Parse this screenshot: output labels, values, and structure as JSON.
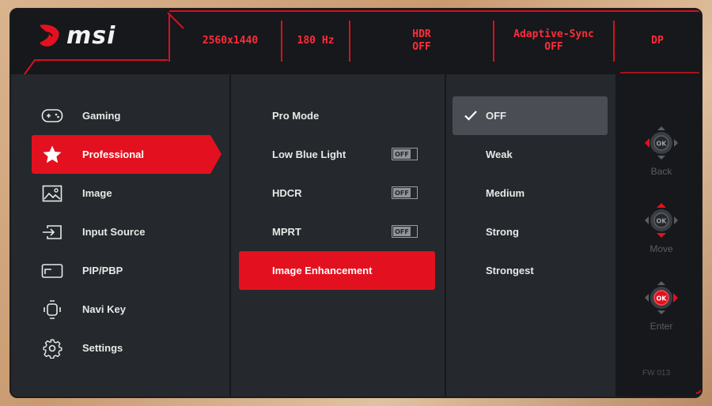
{
  "brand": {
    "name": "msi"
  },
  "status": [
    {
      "lines": [
        "2560x1440"
      ]
    },
    {
      "lines": [
        "180 Hz"
      ]
    },
    {
      "lines": [
        "HDR",
        "OFF"
      ]
    },
    {
      "lines": [
        "Adaptive-Sync",
        "OFF"
      ]
    },
    {
      "lines": [
        "DP"
      ]
    }
  ],
  "menu": [
    {
      "label": "Gaming",
      "icon": "gamepad-icon"
    },
    {
      "label": "Professional",
      "icon": "star-icon",
      "active": true
    },
    {
      "label": "Image",
      "icon": "image-icon"
    },
    {
      "label": "Input Source",
      "icon": "input-source-icon"
    },
    {
      "label": "PIP/PBP",
      "icon": "pip-icon"
    },
    {
      "label": "Navi Key",
      "icon": "navi-key-icon"
    },
    {
      "label": "Settings",
      "icon": "gear-icon"
    }
  ],
  "professional": [
    {
      "label": "Pro Mode"
    },
    {
      "label": "Low Blue Light",
      "toggle": "OFF"
    },
    {
      "label": "HDCR",
      "toggle": "OFF"
    },
    {
      "label": "MPRT",
      "toggle": "OFF"
    },
    {
      "label": "Image Enhancement",
      "active": true
    }
  ],
  "options": [
    {
      "label": "OFF",
      "selected": true
    },
    {
      "label": "Weak"
    },
    {
      "label": "Medium"
    },
    {
      "label": "Strong"
    },
    {
      "label": "Strongest"
    }
  ],
  "nav": {
    "ok_label": "OK",
    "back": "Back",
    "move": "Move",
    "enter": "Enter"
  },
  "firmware": "FW 013",
  "colors": {
    "accent": "#e3111f",
    "panel": "#25282c",
    "background": "#16181b"
  }
}
